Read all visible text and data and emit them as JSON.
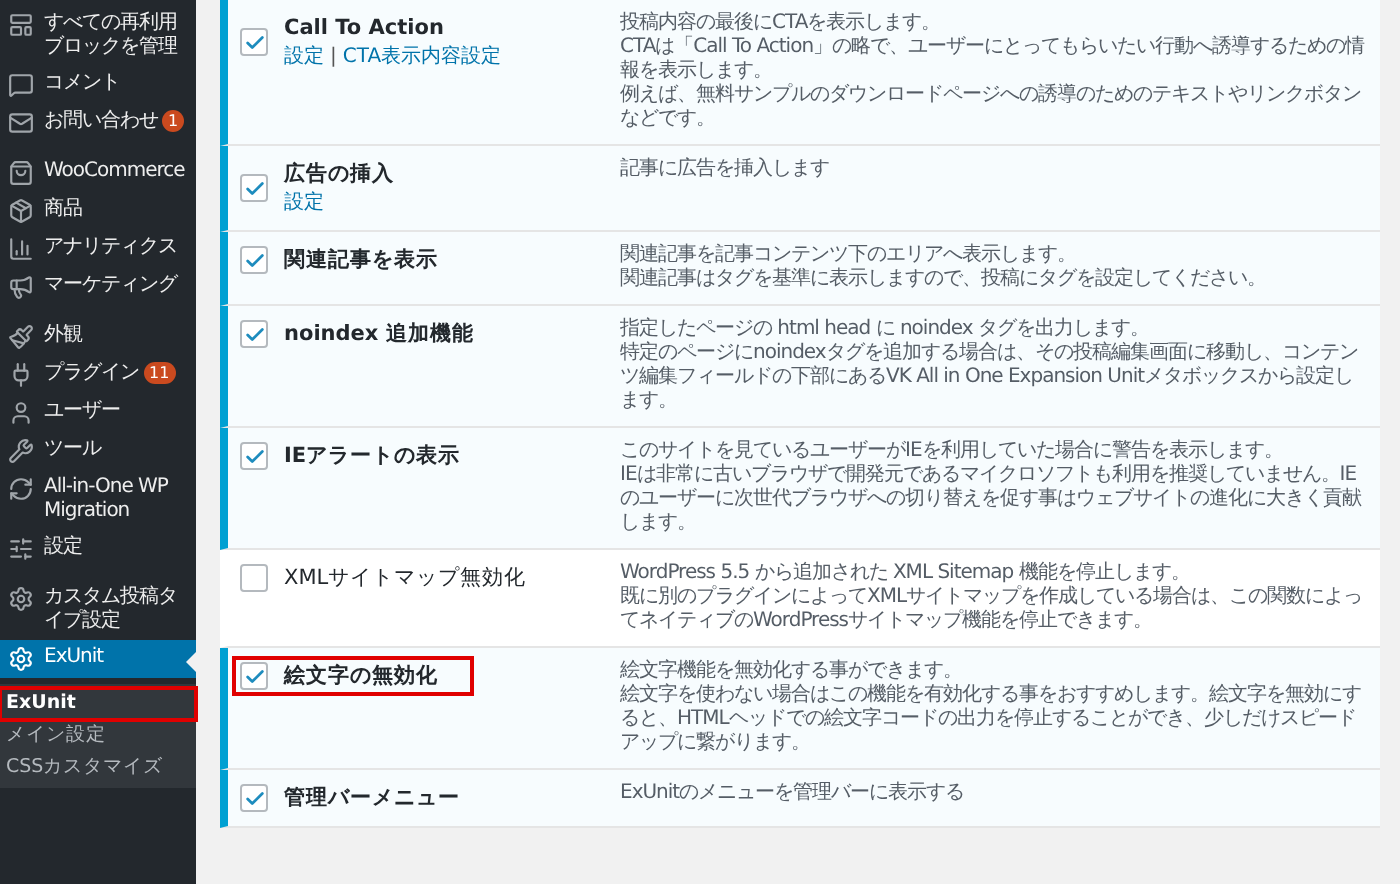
{
  "sidebar": {
    "groups": [
      [
        {
          "label": "すべての再利用ブロックを管理",
          "current": false
        },
        {
          "label": "コメント",
          "current": false
        },
        {
          "label": "お問い合わせ",
          "badge": "1",
          "current": false
        }
      ],
      [
        {
          "label": "WooCommerce",
          "current": false
        },
        {
          "label": "商品",
          "current": false
        },
        {
          "label": "アナリティクス",
          "current": false
        },
        {
          "label": "マーケティング",
          "current": false
        }
      ],
      [
        {
          "label": "外観",
          "current": false
        },
        {
          "label": "プラグイン",
          "badge": "11",
          "current": false
        },
        {
          "label": "ユーザー",
          "current": false
        },
        {
          "label": "ツール",
          "current": false
        },
        {
          "label": "All-in-One WP Migration",
          "current": false
        },
        {
          "label": "設定",
          "current": false
        }
      ],
      [
        {
          "label": "カスタム投稿タイプ設定",
          "current": false
        },
        {
          "label": "ExUnit",
          "current": true
        }
      ]
    ],
    "submenu": [
      {
        "label": "ExUnit",
        "selected": true,
        "highlighted": true
      },
      {
        "label": "メイン設定",
        "selected": false,
        "highlighted": false
      },
      {
        "label": "CSSカスタマイズ",
        "selected": false,
        "highlighted": false
      }
    ]
  },
  "modules": [
    {
      "title": "Call To Action",
      "checked": true,
      "highlighted": false,
      "links": [
        "設定",
        "CTA表示内容設定"
      ],
      "link_separator": "|",
      "description": [
        "投稿内容の最後にCTAを表示します。",
        "CTAは「Call To Action」の略で、ユーザーにとってもらいたい行動へ誘導するための情報を表示します。",
        "例えば、無料サンプルのダウンロードページへの誘導のためのテキストやリンクボタンなどです。"
      ]
    },
    {
      "title": "広告の挿入",
      "checked": true,
      "highlighted": false,
      "links": [
        "設定"
      ],
      "description": [
        "記事に広告を挿入します"
      ]
    },
    {
      "title": "関連記事を表示",
      "checked": true,
      "highlighted": false,
      "description": [
        "関連記事を記事コンテンツ下のエリアへ表示します。",
        "関連記事はタグを基準に表示しますので、投稿にタグを設定してください。"
      ]
    },
    {
      "title": "noindex 追加機能",
      "checked": true,
      "highlighted": false,
      "description": [
        "指定したページの html head に noindex タグを出力します。",
        "特定のページにnoindexタグを追加する場合は、その投稿編集画面に移動し、コンテンツ編集フィールドの下部にあるVK All in One Expansion Unitメタボックスから設定します。"
      ]
    },
    {
      "title": "IEアラートの表示",
      "checked": true,
      "highlighted": false,
      "description": [
        "このサイトを見ているユーザーがIEを利用していた場合に警告を表示します。",
        "IEは非常に古いブラウザで開発元であるマイクロソフトも利用を推奨していません。IEのユーザーに次世代ブラウザへの切り替えを促す事はウェブサイトの進化に大きく貢献します。"
      ]
    },
    {
      "title": "XMLサイトマップ無効化",
      "checked": false,
      "highlighted": false,
      "description": [
        "WordPress 5.5 から追加された XML Sitemap 機能を停止します。",
        "既に別のプラグインによってXMLサイトマップを作成している場合は、この関数によってネイティブのWordPressサイトマップ機能を停止できます。"
      ]
    },
    {
      "title": "絵文字の無効化",
      "checked": true,
      "highlighted": true,
      "description": [
        "絵文字機能を無効化する事ができます。",
        "絵文字を使わない場合はこの機能を有効化する事をおすすめします。絵文字を無効にすると、HTMLヘッドでの絵文字コードの出力を停止することができ、少しだけスピードアップに繋がります。"
      ]
    },
    {
      "title": "管理バーメニュー",
      "checked": true,
      "highlighted": false,
      "description": [
        "ExUnitのメニューを管理バーに表示する"
      ]
    }
  ]
}
